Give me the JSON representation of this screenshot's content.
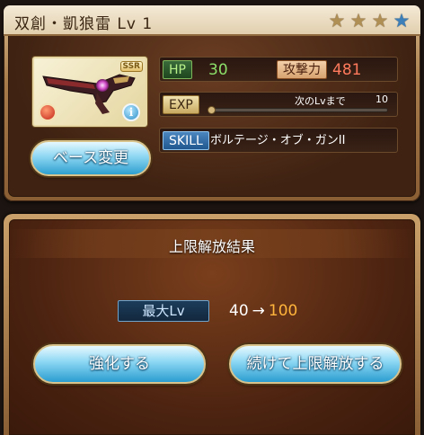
{
  "item": {
    "title": "双創・凱狼雷 Lv 1",
    "rarity_badge": "SSR",
    "stars": [
      {
        "type": "filled"
      },
      {
        "type": "filled"
      },
      {
        "type": "filled"
      },
      {
        "type": "empty"
      }
    ],
    "star_glyph": "★",
    "info_glyph": "i",
    "base_change_label": "ベース変更",
    "hp": {
      "label": "HP",
      "value": "30"
    },
    "atk": {
      "label": "攻撃力",
      "value": "481"
    },
    "exp": {
      "label": "EXP",
      "next_text": "次のLvまで",
      "next_value": "10",
      "progress": 0
    },
    "skill": {
      "label": "SKILL",
      "name": "ボルテージ・オブ・ガンII"
    }
  },
  "result": {
    "title": "上限解放結果",
    "max_lv_label": "最大Lv",
    "from": "40",
    "arrow": "→",
    "to": "100",
    "enhance_label": "強化する",
    "continue_label": "続けて上限解放する"
  },
  "colors": {
    "hp_value": "#8ce06a",
    "atk_value": "#ff7a5c",
    "lv_to": "#ffb43b",
    "button_blue": "#2b9dd0"
  }
}
